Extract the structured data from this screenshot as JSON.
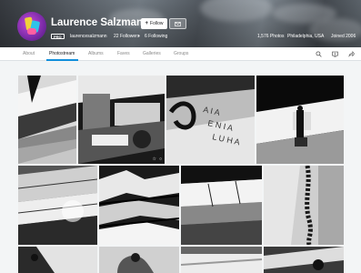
{
  "profile": {
    "name": "Laurence Salzmann",
    "username": "laurencesalzmann",
    "badge": "PRO",
    "followers": "22 Followers",
    "following": "6 Following",
    "follow_label": "Follow"
  },
  "stats": {
    "photos": "1,576 Photos",
    "location": "Philadelphia, USA",
    "joined": "Joined 2006"
  },
  "nav": {
    "tabs": [
      {
        "label": "About"
      },
      {
        "label": "Photostream"
      },
      {
        "label": "Albums"
      },
      {
        "label": "Faves"
      },
      {
        "label": "Galleries"
      },
      {
        "label": "Groups"
      }
    ],
    "active_tab": "Photostream",
    "icons": [
      "search-icon",
      "slideshow-icon",
      "share-icon"
    ]
  },
  "photo_overlay": {
    "fave_icon": "☆",
    "comment_icon": "○"
  },
  "colors": {
    "accent": "#128fdc",
    "nav_bg": "#ffffff",
    "page_bg": "#f3f5f6"
  }
}
